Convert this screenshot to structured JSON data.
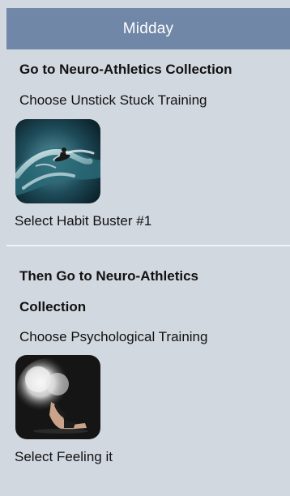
{
  "header": {
    "title": "Midday"
  },
  "step1": {
    "title": "Go to Neuro-Athletics Collection",
    "subtitle": "Choose Unstick Stuck Training",
    "image_label": "surfer-thumbnail",
    "action": "Select Habit Buster #1"
  },
  "step2": {
    "title_line1": "Then Go to Neuro-Athletics",
    "title_line2": "Collection",
    "subtitle": "Choose Psychological Training",
    "image_label": "chalk-athlete-thumbnail",
    "action": "Select Feeling it"
  },
  "colors": {
    "header_bg": "#7187a8",
    "panel_bg": "#d2d8e0",
    "divider": "#f2f4f7"
  }
}
